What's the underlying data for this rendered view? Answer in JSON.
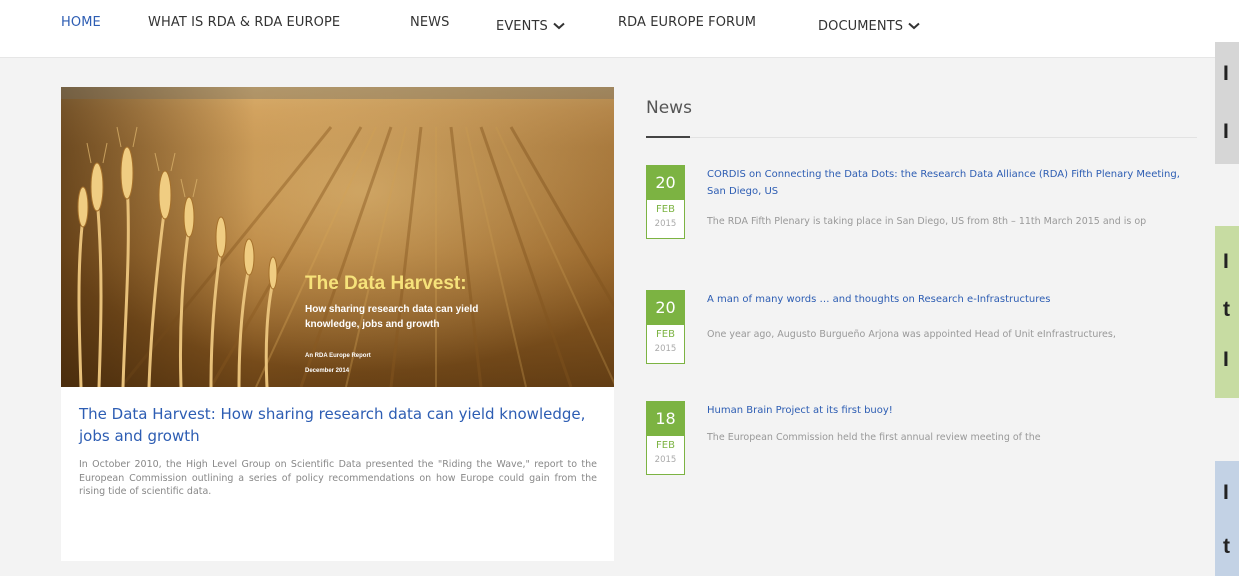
{
  "nav": {
    "items": [
      {
        "label": "HOME"
      },
      {
        "label": "WHAT IS RDA & RDA EUROPE"
      },
      {
        "label": "NEWS"
      },
      {
        "label": "EVENTS"
      },
      {
        "label": "RDA EUROPE FORUM"
      },
      {
        "label": "DOCUMENTS"
      }
    ],
    "active_color": "#2d5db3"
  },
  "feature": {
    "image": {
      "title": "The Data Harvest:",
      "subtitle": "How sharing research data can yield knowledge, jobs and growth",
      "report_line": "An RDA Europe Report",
      "date_line": "December 2014"
    },
    "title": "The Data Harvest: How sharing research data can yield knowledge, jobs and growth",
    "description": "In October 2010, the High Level Group on Scientific Data presented the \"Riding the Wave,\" report to the European Commission outlining a series of policy recommendations on how Europe could gain from the rising tide of scientific data."
  },
  "news": {
    "heading": "News",
    "accent_color": "#7cb342",
    "items": [
      {
        "day": "20",
        "month": "FEB",
        "year": "2015",
        "title": "CORDIS on Connecting the Data Dots: the Research Data Alliance (RDA) Fifth Plenary Meeting, San Diego, US",
        "excerpt": "The RDA Fifth Plenary is taking place in San Diego, US from 8th – 11th March 2015 and is op"
      },
      {
        "day": "20",
        "month": "FEB",
        "year": "2015",
        "title": "A man of many words … and thoughts on Research e-Infrastructures",
        "excerpt": "One year ago, Augusto Burgueño Arjona was appointed Head of Unit eInfrastructures,"
      },
      {
        "day": "18",
        "month": "FEB",
        "year": "2015",
        "title": "Human Brain Project at its first buoy!",
        "excerpt": "The European Commission held the first annual review meeting of the"
      }
    ]
  },
  "side_panels": [
    {
      "letters": [
        "I",
        "I"
      ]
    },
    {
      "letters": [
        "I",
        "t",
        "I"
      ]
    },
    {
      "letters": [
        "I",
        "t"
      ]
    }
  ]
}
